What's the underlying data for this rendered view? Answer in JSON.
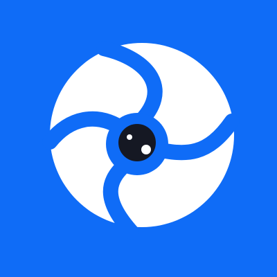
{
  "app_icon": {
    "name": "aperture-eye-logo",
    "icon": "aperture-eye-icon",
    "colors": {
      "background": "#0F6CF7",
      "blade": "#FFFFFF",
      "pupil": "#151823",
      "highlight": "#FFFFFF"
    }
  }
}
